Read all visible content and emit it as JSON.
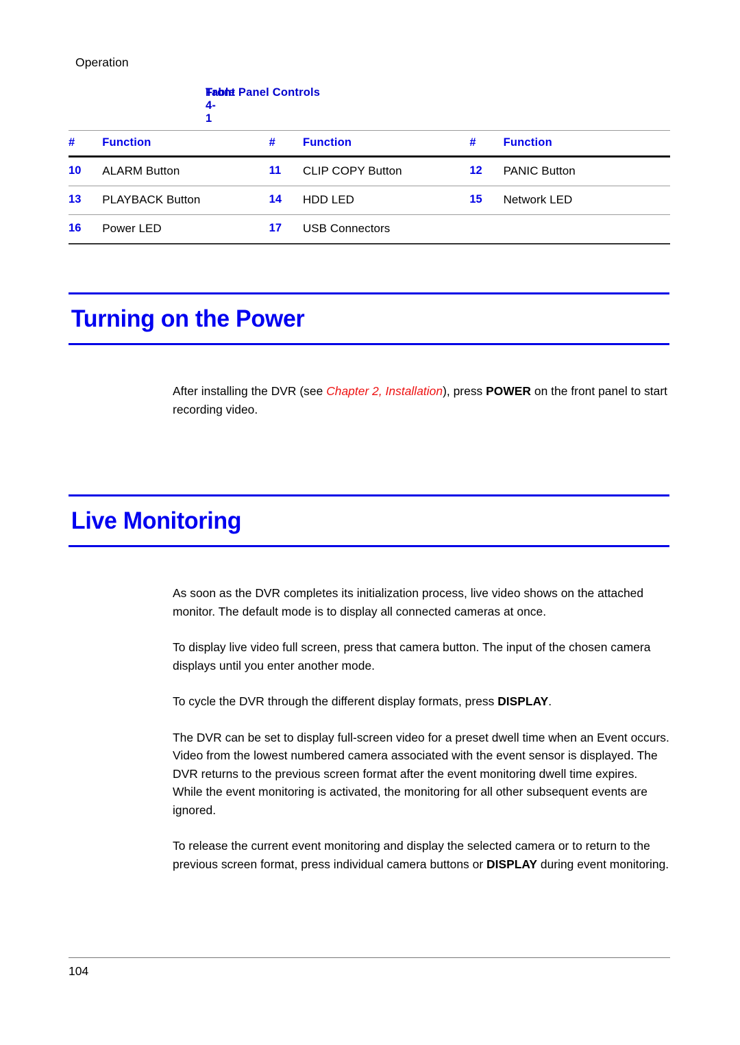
{
  "page": {
    "running_header": "Operation",
    "page_number": "104",
    "accent_blue": "#0000e6",
    "heading_blue": "#0000f0",
    "cross_ref_red": "#ee1111"
  },
  "table": {
    "caption_number": "Table  4-1",
    "caption_title": "Front Panel Controls",
    "columns": [
      "#",
      "Function",
      "#",
      "Function",
      "#",
      "Function"
    ],
    "rows": [
      [
        "10",
        "ALARM Button",
        "11",
        "CLIP COPY Button",
        "12",
        "PANIC Button"
      ],
      [
        "13",
        "PLAYBACK Button",
        "14",
        "HDD LED",
        "15",
        "Network LED"
      ],
      [
        "16",
        "Power LED",
        "17",
        "USB Connectors",
        "",
        ""
      ]
    ]
  },
  "sections": [
    {
      "title": "Turning on the Power",
      "paragraphs": [
        {
          "runs": [
            {
              "text": "After installing the DVR (see ",
              "style": "normal"
            },
            {
              "text": "Chapter 2, Installation",
              "style": "red-italic"
            },
            {
              "text": "), press ",
              "style": "normal"
            },
            {
              "text": "POWER",
              "style": "bold"
            },
            {
              "text": " on the front panel to start recording video.",
              "style": "normal"
            }
          ]
        }
      ]
    },
    {
      "title": "Live Monitoring",
      "paragraphs": [
        {
          "runs": [
            {
              "text": "As soon as the DVR completes its initialization process, live video shows on the attached monitor. The default mode is to display all connected cameras at once.",
              "style": "normal"
            }
          ]
        },
        {
          "runs": [
            {
              "text": "To display live video full screen, press that camera button. The input of the chosen camera displays until you enter another mode.",
              "style": "normal"
            }
          ]
        },
        {
          "runs": [
            {
              "text": "To cycle the DVR through the different display formats, press ",
              "style": "normal"
            },
            {
              "text": "DISPLAY",
              "style": "bold"
            },
            {
              "text": ".",
              "style": "normal"
            }
          ]
        },
        {
          "runs": [
            {
              "text": "The DVR can be set to display full-screen video for a preset dwell time when an Event occurs. Video from the lowest numbered camera associated with the event sensor is displayed. The DVR returns to the previous screen format after the event monitoring dwell time expires. While the event monitoring is activated, the monitoring for all other subsequent events are ignored.",
              "style": "normal"
            }
          ]
        },
        {
          "runs": [
            {
              "text": "To release the current event monitoring and display the selected camera or to return to the previous screen format, press individual camera buttons or ",
              "style": "normal"
            },
            {
              "text": "DISPLAY",
              "style": "bold"
            },
            {
              "text": " during event monitoring.",
              "style": "normal"
            }
          ]
        }
      ]
    }
  ]
}
